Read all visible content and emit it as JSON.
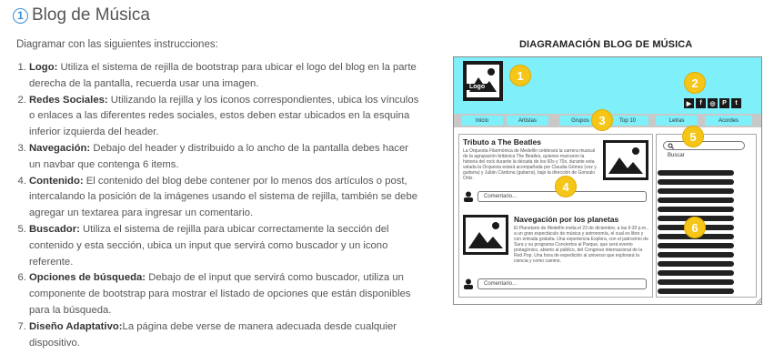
{
  "page": {
    "number": "1",
    "title": "Blog de Música",
    "intro": "Diagramar con las siguientes instrucciones:"
  },
  "instructions": [
    {
      "label": "Logo:",
      "text": " Utiliza el sistema de rejilla de bootstrap para ubicar el logo del blog en la parte derecha de la pantalla, recuerda usar una imagen."
    },
    {
      "label": "Redes Sociales:",
      "text": " Utilizando la rejilla y los iconos correspondientes, ubica los vínculos o enlaces a las diferentes redes sociales, estos deben estar ubicados en la esquina inferior izquierda del header."
    },
    {
      "label": "Navegación:",
      "text": " Debajo del header y distribuido a lo ancho de la pantalla debes hacer un navbar que contenga 6 items."
    },
    {
      "label": "Contenido:",
      "text": " El contenido del blog debe contener por lo menos dos artículos o post, intercalando la posición de la imágenes usando el sistema de rejilla, también se debe agregar un textarea para ingresar un comentario."
    },
    {
      "label": "Buscador:",
      "text": " Utiliza el sistema de rejilla para ubicar correctamente la sección del contenido y esta sección, ubica un input que servirá como buscador y un icono referente."
    },
    {
      "label": "Opciones de búsqueda:",
      "text": " Debajo de el input que servirá como buscador, utiliza un componente de bootstrap para mostrar el listado de opciones que están disponibles para la búsqueda."
    },
    {
      "label": "Diseño Adaptativo:",
      "text": "La página debe verse de manera adecuada desde cualquier dispositivo."
    }
  ],
  "figure": {
    "title": "DIAGRAMACIÓN BLOG DE MÚSICA",
    "logo_text": "Logo",
    "social_icons": [
      "youtube-icon",
      "facebook-icon",
      "instagram-icon",
      "pinterest-icon",
      "twitter-icon"
    ],
    "nav_items": [
      "Inicio",
      "Artistas",
      "Grupos",
      "Top 10",
      "Letras",
      "Acordes"
    ],
    "badges": [
      "1",
      "2",
      "3",
      "4",
      "5",
      "6"
    ],
    "post1_title": "Tributo a The Beatles",
    "post1_text": "La Orquesta Filarmónica de Medellín celebrará la carrera musical de la agrupación británica The Beatles, quienes marcaron la historia del rock durante la década de los 60s y 70s, durante esta velada la Orquesta estará acompañada por Claudia Gómez (voz y guitarra) y Julián Cárdona (guitarra), bajo la dirección de Gonzalo Ortiz.",
    "post2_title": "Navegación por los planetas",
    "post2_text": "El Planetario de Medellín invita el 23 de diciembre, a las 6:30 p.m., a un gran espectáculo de música y astronomía, el cual es libre y con entrada gratuita. Una experiencia Explora, con el patrocinio de Sura y su programa Conciertos al Parque, que será evento protagónico, abierto al público, del Congreso internacional de la Red Pop. Una hora de expedición al universo que explorará la ciencia y como camino.",
    "comment_placeholder": "Comentario...",
    "search_label": "Buscar",
    "accent_color": "#7feffa",
    "badge_color": "#f5c518"
  }
}
